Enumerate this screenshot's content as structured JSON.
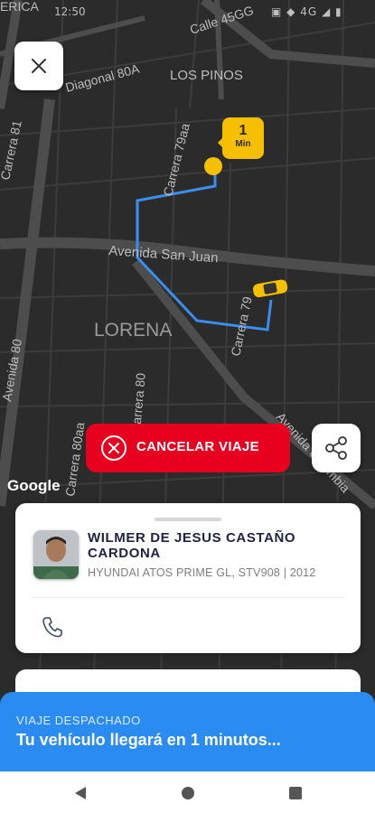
{
  "status_bar": {
    "time": "12:50",
    "indicators": "▣ ◆ 4G ◢ ▮"
  },
  "map": {
    "streets": {
      "calle_45gg": "Calle 45GG",
      "diagonal_80a": "Diagonal 80A",
      "los_pinos": "LOS PINOS",
      "carrera_81": "Carrera 81",
      "carrera_79aa": "Carrera 79aa",
      "avenida_san_juan": "Avenida San Juan",
      "lorena": "LORENA",
      "carrera_79": "Carrera 79",
      "avenida_80": "Avenida 80",
      "carrera_80": "Carrera 80",
      "carrera_80aa": "Carrera 80aa",
      "avenida_colombia": "Avenida Colombia",
      "erica": "ERICA"
    },
    "attribution": "Google",
    "route_color": "#3a8ef0",
    "taxi_color": "#f6c000"
  },
  "eta_badge": {
    "value": "1",
    "unit": "Min"
  },
  "cancel_button": {
    "label": "CANCELAR VIAJE",
    "color": "#e8001f"
  },
  "driver": {
    "name": "WILMER DE JESUS CASTAÑO CARDONA",
    "vehicle": "HYUNDAI ATOS PRIME GL, STV908 | 2012"
  },
  "dispatch": {
    "status": "VIAJE DESPACHADO",
    "message": "Tu vehículo llegará en 1 minutos...",
    "color": "#2a8cf0"
  },
  "icons": {
    "close": "close-icon",
    "share": "share-icon",
    "cancel": "cancel-circle-icon",
    "phone": "phone-icon",
    "back": "back-icon",
    "home": "home-icon",
    "recents": "recents-icon"
  }
}
